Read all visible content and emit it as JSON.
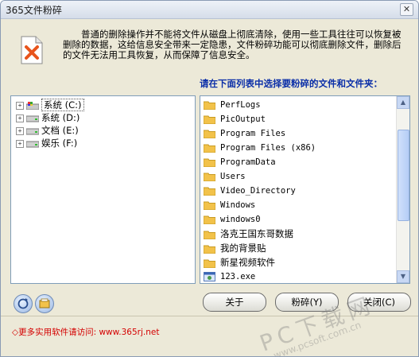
{
  "window": {
    "title": "365文件粉碎",
    "close_glyph": "✕"
  },
  "description": "普通的删除操作并不能将文件从磁盘上彻底清除，使用一些工具往往可以恢复被删除的数据，这给信息安全带来一定隐患，文件粉碎功能可以彻底删除文件，删除后的文件无法用工具恢复，从而保障了信息安全。",
  "prompt": "请在下面列表中选择要粉碎的文件和文件夹：",
  "tree": [
    {
      "label": "系统 (C:)",
      "expander": "+",
      "selected": true
    },
    {
      "label": "系统 (D:)",
      "expander": "+",
      "selected": false
    },
    {
      "label": "文档 (E:)",
      "expander": "+",
      "selected": false
    },
    {
      "label": "娱乐 (F:)",
      "expander": "+",
      "selected": false
    }
  ],
  "files": [
    {
      "name": "PerfLogs",
      "type": "folder"
    },
    {
      "name": "PicOutput",
      "type": "folder"
    },
    {
      "name": "Program Files",
      "type": "folder"
    },
    {
      "name": "Program Files (x86)",
      "type": "folder"
    },
    {
      "name": "ProgramData",
      "type": "folder"
    },
    {
      "name": "Users",
      "type": "folder"
    },
    {
      "name": "Video_Directory",
      "type": "folder"
    },
    {
      "name": "Windows",
      "type": "folder"
    },
    {
      "name": "windows0",
      "type": "folder"
    },
    {
      "name": "洛克王国东哥数据",
      "type": "folder"
    },
    {
      "name": "我的背景贴",
      "type": "folder"
    },
    {
      "name": "新星视频软件",
      "type": "folder"
    },
    {
      "name": "123.exe",
      "type": "exe"
    }
  ],
  "buttons": {
    "about": "关于",
    "shred": "粉碎(Y)",
    "close": "关闭(C)"
  },
  "footer": {
    "text": "◇更多实用软件请访问: www.365rj.net"
  },
  "watermark": {
    "logo": "PC下载网",
    "url": "www.pcsoft.com.cn"
  },
  "colors": {
    "prompt": "#0a2ea8",
    "footer_link": "#d40000",
    "folder": "#f2c24a"
  }
}
